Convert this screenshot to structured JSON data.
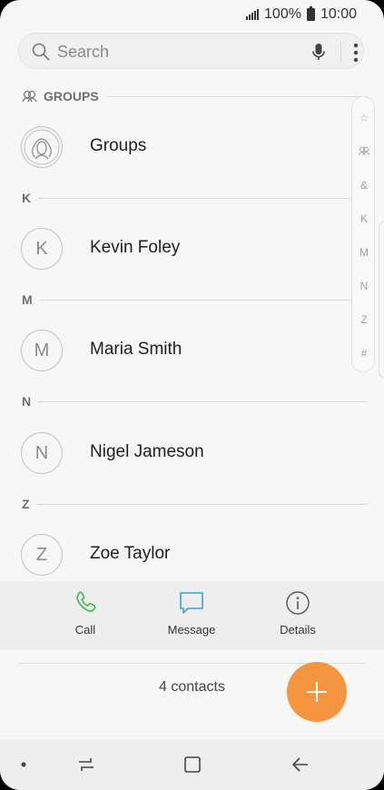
{
  "status_bar": {
    "battery": "100%",
    "time": "10:00"
  },
  "search": {
    "placeholder": "Search"
  },
  "sections": {
    "groups": "GROUPS",
    "k": "K",
    "m": "M",
    "n": "N",
    "z": "Z"
  },
  "contacts": [
    {
      "initial": "",
      "name": "Groups"
    },
    {
      "initial": "K",
      "name": "Kevin Foley"
    },
    {
      "initial": "M",
      "name": "Maria Smith"
    },
    {
      "initial": "N",
      "name": "Nigel Jameson"
    },
    {
      "initial": "Z",
      "name": "Zoe Taylor"
    }
  ],
  "index_bar": [
    "☆",
    "",
    "&",
    "K",
    "M",
    "N",
    "Z",
    "#"
  ],
  "actions": {
    "call": "Call",
    "message": "Message",
    "details": "Details"
  },
  "footer": {
    "count": "4 contacts"
  },
  "colors": {
    "accent": "#f5953f",
    "call_green": "#3dba4e",
    "message_blue": "#3aa0d8"
  }
}
